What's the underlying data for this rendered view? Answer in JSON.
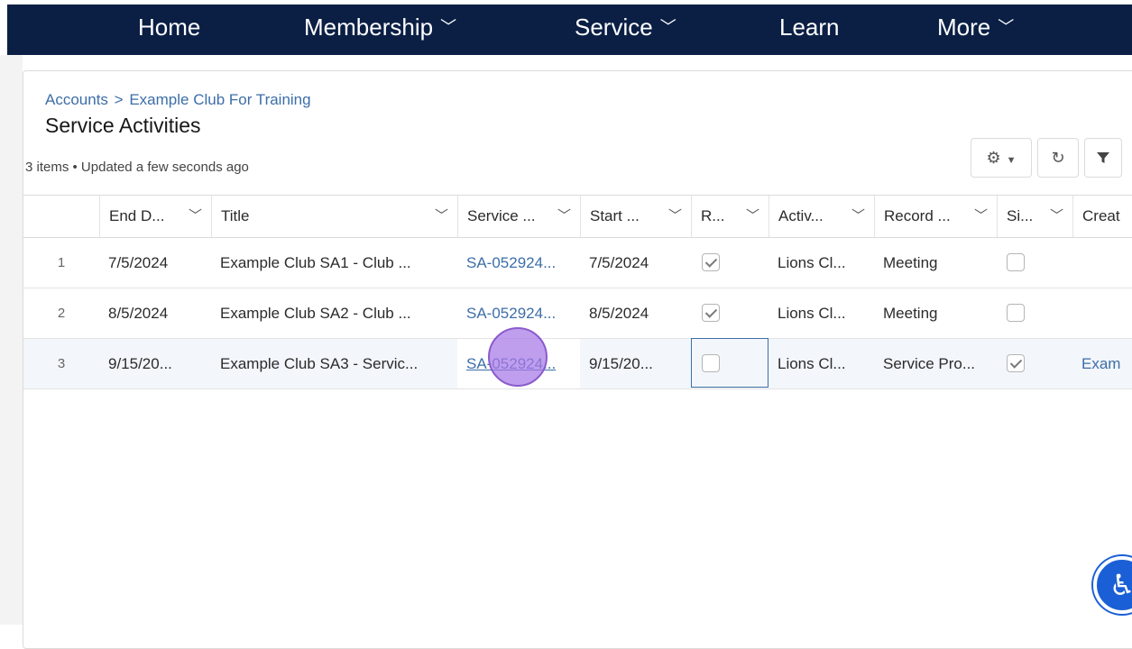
{
  "nav": {
    "items": [
      {
        "label": "Home",
        "has_menu": false
      },
      {
        "label": "Membership",
        "has_menu": true
      },
      {
        "label": "Service",
        "has_menu": true
      },
      {
        "label": "Learn",
        "has_menu": false
      },
      {
        "label": "More",
        "has_menu": true
      }
    ]
  },
  "breadcrumb": {
    "parent": "Accounts",
    "separator": ">",
    "current": "Example Club For Training"
  },
  "page": {
    "title": "Service Activities",
    "meta": "3 items • Updated a few seconds ago"
  },
  "toolbar": {
    "settings_icon": "gear-icon",
    "refresh_icon": "refresh-icon",
    "filter_icon": "filter-icon"
  },
  "table": {
    "columns": [
      "End D...",
      "Title",
      "Service ...",
      "Start ...",
      "R...",
      "Activ...",
      "Record ...",
      "Si...",
      "Creat"
    ],
    "rows": [
      {
        "num": "1",
        "end_date": "7/5/2024",
        "title": "Example Club SA1 - Club ...",
        "service": "SA-052924...",
        "start": "7/5/2024",
        "r": true,
        "activity": "Lions Cl...",
        "record": "Meeting",
        "si": false,
        "created": ""
      },
      {
        "num": "2",
        "end_date": "8/5/2024",
        "title": "Example Club SA2 - Club ...",
        "service": "SA-052924...",
        "start": "8/5/2024",
        "r": true,
        "activity": "Lions Cl...",
        "record": "Meeting",
        "si": false,
        "created": ""
      },
      {
        "num": "3",
        "end_date": "9/15/20...",
        "title": "Example Club SA3 - Servic...",
        "service": "SA-052924...",
        "start": "9/15/20...",
        "r": false,
        "activity": "Lions Cl...",
        "record": "Service Pro...",
        "si": true,
        "created": "Exam"
      }
    ]
  },
  "colors": {
    "nav_bg": "#0b1f45",
    "link": "#3d6ea8",
    "cursor": "#a878e8",
    "a11y": "#1b5fd6"
  }
}
